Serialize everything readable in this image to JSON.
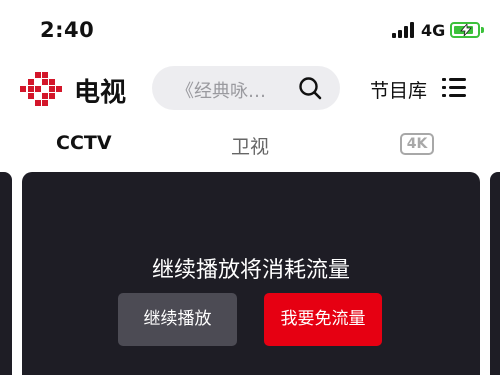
{
  "status_bar": {
    "time": "2:40",
    "network": "4G",
    "battery_level": 0.85,
    "battery_color": "#3cc13b"
  },
  "header": {
    "logo_icon": "cctv-logo-icon",
    "title": "电视",
    "search": {
      "text": "《经典咏…",
      "icon": "search-icon"
    },
    "library_label": "节目库",
    "library_icon": "list-icon"
  },
  "tabs": [
    {
      "label": "CCTV",
      "selected": true
    },
    {
      "label": "卫视",
      "selected": false
    },
    {
      "label": "4K",
      "selected": false
    }
  ],
  "player": {
    "message": "继续播放将消耗流量",
    "continue_label": "继续播放",
    "free_data_label": "我要免流量",
    "accent_color": "#e60012"
  }
}
